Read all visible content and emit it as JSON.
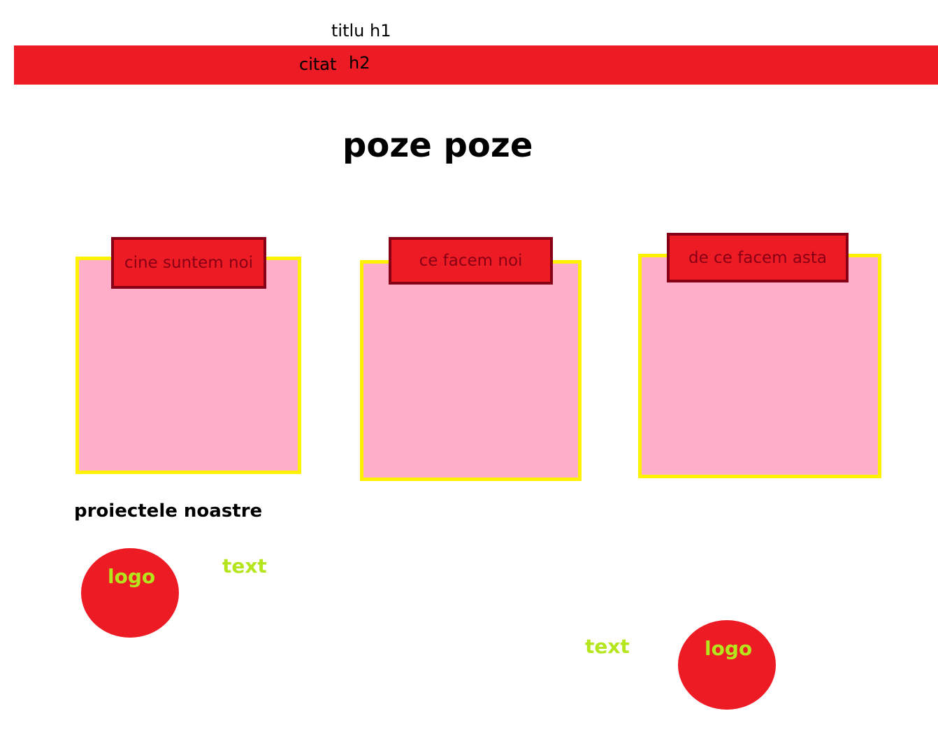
{
  "header": {
    "title_h1": "titlu h1",
    "quote": "citat",
    "quote_h2": "h2"
  },
  "gallery": {
    "heading": "poze poze",
    "cards": [
      {
        "label": "cine suntem noi"
      },
      {
        "label": "ce facem noi"
      },
      {
        "label": "de ce facem asta"
      }
    ]
  },
  "projects": {
    "heading": "proiectele noastre",
    "items": [
      {
        "logo": "logo",
        "text": "text"
      },
      {
        "logo": "logo",
        "text": "text"
      }
    ]
  },
  "colors": {
    "accent_red": "#ed1c24",
    "dark_red": "#880015",
    "card_pink": "#ffaec9",
    "card_border_yellow": "#fff200",
    "lime_text": "#b5e61d"
  }
}
